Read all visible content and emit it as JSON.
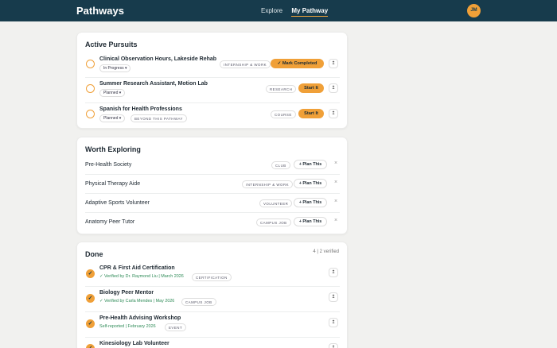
{
  "app": {
    "title": "Pathways"
  },
  "nav": {
    "items": [
      "Explore",
      "My Pathway"
    ],
    "active": "My Pathway"
  },
  "user": {
    "initials": "JM"
  },
  "active_pursuits": {
    "title": "Active Pursuits",
    "items": [
      {
        "title": "Clinical Observation Hours, Lakeside Rehab",
        "status": "In Progress ▾",
        "tag": "Internship & Work",
        "action": "✓ Mark Completed",
        "extra_tag": ""
      },
      {
        "title": "Summer Research Assistant, Motion Lab",
        "status": "Planned ▾",
        "tag": "Research",
        "action": "Start It",
        "extra_tag": ""
      },
      {
        "title": "Spanish for Health Professions",
        "status": "Planned ▾",
        "tag": "Course",
        "action": "Start It",
        "extra_tag": "Beyond this pathway"
      }
    ]
  },
  "worth_exploring": {
    "title": "Worth Exploring",
    "plan_label": "+ Plan This",
    "items": [
      {
        "title": "Pre-Health Society",
        "tag": "Club"
      },
      {
        "title": "Physical Therapy Aide",
        "tag": "Internship & Work"
      },
      {
        "title": "Adaptive Sports Volunteer",
        "tag": "Volunteer"
      },
      {
        "title": "Anatomy Peer Tutor",
        "tag": "Campus Job"
      }
    ]
  },
  "done": {
    "title": "Done",
    "count": "4 | 2 verified",
    "items": [
      {
        "title": "CPR & First Aid Certification",
        "note": "✓ Verified by Dr. Raymond Liu | March 2026",
        "tag": "Certification"
      },
      {
        "title": "Biology Peer Mentor",
        "note": "✓ Verified by Carla Mendes | May 2026",
        "tag": "Campus Job"
      },
      {
        "title": "Pre-Health Advising Workshop",
        "note": "Self-reported | February 2026",
        "tag": "Event"
      },
      {
        "title": "Kinesiology Lab Volunteer",
        "note": "",
        "tag": ""
      }
    ]
  },
  "icons": {
    "upload": "upload-icon",
    "dismiss": "close-icon",
    "check": "check-icon"
  },
  "colors": {
    "header": "#173b4c",
    "accent": "#f0a038",
    "verified": "#2e8b57"
  }
}
